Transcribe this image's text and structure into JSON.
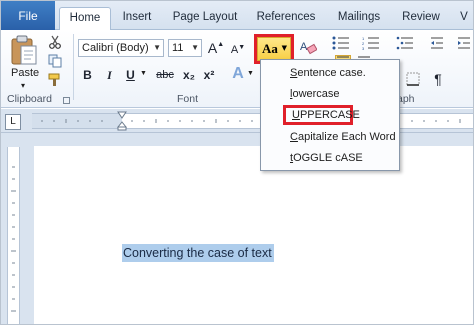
{
  "tabs": {
    "file": "File",
    "items": [
      "Home",
      "Insert",
      "Page Layout",
      "References",
      "Mailings",
      "Review",
      "V"
    ]
  },
  "clipboard": {
    "paste_label": "Paste",
    "group_label": "Clipboard"
  },
  "font": {
    "name_value": "Calibri (Body)",
    "size_value": "11",
    "group_label": "Font",
    "grow": "A",
    "shrink": "A",
    "bold": "B",
    "italic": "I",
    "underline": "U",
    "strike": "abc",
    "subscript": "x₂",
    "superscript": "x²",
    "effects": "A",
    "change_case": "Aa"
  },
  "paragraph": {
    "group_label": "aph",
    "pilcrow": "¶"
  },
  "change_case_menu": {
    "items": [
      {
        "text": "entence case.",
        "accel": "S"
      },
      {
        "text": "owercase",
        "accel": "l"
      },
      {
        "text": "PPERCASE",
        "accel": "U"
      },
      {
        "text": "apitalize Each Word",
        "accel": "C"
      },
      {
        "text": "OGGLE cASE",
        "accel": "t"
      }
    ],
    "highlighted_index": 2
  },
  "document": {
    "selected_text": "Converting the case of text"
  },
  "ruler": {
    "tab_selector": "L"
  },
  "colors": {
    "file_tab": "#2f6db6",
    "highlight_box": "#e0202a",
    "selection": "#aecdec",
    "change_case_button": "#f8cf45"
  }
}
